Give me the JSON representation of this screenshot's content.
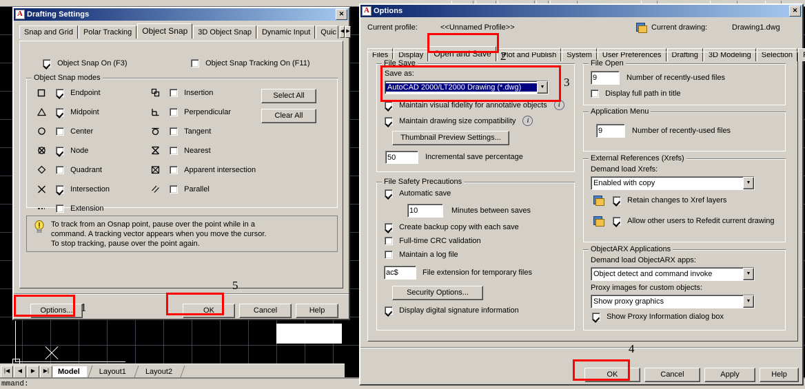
{
  "acad": {
    "command_prompt": "mmand:",
    "nav_buttons": [
      "|◀",
      "◀",
      "▶",
      "▶|"
    ],
    "layout_tabs": [
      {
        "label": "Model",
        "active": true
      },
      {
        "label": "Layout1",
        "active": false
      },
      {
        "label": "Layout2",
        "active": false
      }
    ]
  },
  "drafting": {
    "title": "Drafting Settings",
    "close_label": "✕",
    "tabs": [
      {
        "label": "Snap and Grid",
        "selected": false
      },
      {
        "label": "Polar Tracking",
        "selected": false
      },
      {
        "label": "Object Snap",
        "selected": true
      },
      {
        "label": "3D Object Snap",
        "selected": false
      },
      {
        "label": "Dynamic Input",
        "selected": false
      },
      {
        "label": "Quic",
        "selected": false
      }
    ],
    "scroll_left": "◀",
    "scroll_right": "▶",
    "osnap_on": {
      "label": "Object Snap On (F3)",
      "checked": true
    },
    "osnap_tracking_on": {
      "label": "Object Snap Tracking On (F11)",
      "checked": false
    },
    "modes_group_label": "Object Snap modes",
    "modes_left": [
      {
        "label": "Endpoint",
        "checked": true,
        "icon": "square-icon"
      },
      {
        "label": "Midpoint",
        "checked": true,
        "icon": "triangle-icon"
      },
      {
        "label": "Center",
        "checked": false,
        "icon": "circle-icon"
      },
      {
        "label": "Node",
        "checked": true,
        "icon": "circled-x-icon"
      },
      {
        "label": "Quadrant",
        "checked": false,
        "icon": "diamond-icon"
      },
      {
        "label": "Intersection",
        "checked": true,
        "icon": "x-cross-icon"
      },
      {
        "label": "Extension",
        "checked": false,
        "icon": "dashed-line-icon"
      }
    ],
    "modes_right": [
      {
        "label": "Insertion",
        "checked": false,
        "icon": "insertion-icon"
      },
      {
        "label": "Perpendicular",
        "checked": false,
        "icon": "perpendicular-icon"
      },
      {
        "label": "Tangent",
        "checked": false,
        "icon": "tangent-icon"
      },
      {
        "label": "Nearest",
        "checked": false,
        "icon": "hourglass-icon"
      },
      {
        "label": "Apparent intersection",
        "checked": false,
        "icon": "boxed-x-icon"
      },
      {
        "label": "Parallel",
        "checked": false,
        "icon": "parallel-icon"
      }
    ],
    "select_all_label": "Select All",
    "clear_all_label": "Clear All",
    "tip_line1": "To track from an Osnap point, pause over the point while in a",
    "tip_line2": "command.  A tracking vector appears when you move the cursor.",
    "tip_line3": "To stop tracking, pause over the point again.",
    "options_label": "Options...",
    "ok_label": "OK",
    "cancel_label": "Cancel",
    "help_label": "Help"
  },
  "options": {
    "title": "Options",
    "close_label": "✕",
    "current_profile_label": "Current profile:",
    "current_profile_value": "<<Unnamed Profile>>",
    "current_drawing_label": "Current drawing:",
    "current_drawing_value": "Drawing1.dwg",
    "tabs": [
      {
        "label": "Files",
        "selected": false
      },
      {
        "label": "Display",
        "selected": false
      },
      {
        "label": "Open and Save",
        "selected": true
      },
      {
        "label": "Plot and Publish",
        "selected": false
      },
      {
        "label": "System",
        "selected": false
      },
      {
        "label": "User Preferences",
        "selected": false
      },
      {
        "label": "Drafting",
        "selected": false
      },
      {
        "label": "3D Modeling",
        "selected": false
      },
      {
        "label": "Selection",
        "selected": false
      },
      {
        "label": "Profiles",
        "selected": false
      }
    ],
    "file_save": {
      "group_label": "File Save",
      "save_as_label": "Save as:",
      "save_as_value": "AutoCAD 2000/LT2000 Drawing (*.dwg)",
      "maintain_visual_fidelity": {
        "label": "Maintain visual fidelity for annotative objects",
        "checked": true
      },
      "maintain_size_compat": {
        "label": "Maintain drawing size compatibility",
        "checked": true
      },
      "thumbnail_button": "Thumbnail Preview Settings...",
      "incremental_value": "50",
      "incremental_label": "Incremental save percentage"
    },
    "file_safety": {
      "group_label": "File Safety Precautions",
      "automatic_save": {
        "label": "Automatic save",
        "checked": true
      },
      "minutes_value": "10",
      "minutes_label": "Minutes between saves",
      "create_backup": {
        "label": "Create backup copy with each save",
        "checked": true
      },
      "crc_validation": {
        "label": "Full-time CRC validation",
        "checked": false
      },
      "log_file": {
        "label": "Maintain a log file",
        "checked": false
      },
      "temp_ext_value": "ac$",
      "temp_ext_label": "File extension for temporary files",
      "security_button": "Security Options...",
      "digital_signature": {
        "label": "Display digital signature information",
        "checked": true
      }
    },
    "file_open": {
      "group_label": "File Open",
      "recent_value": "9",
      "recent_label": "Number of recently-used files",
      "full_path": {
        "label": "Display full path in title",
        "checked": false
      }
    },
    "app_menu": {
      "group_label": "Application Menu",
      "recent_value": "9",
      "recent_label": "Number of recently-used files"
    },
    "xrefs": {
      "group_label": "External References (Xrefs)",
      "demand_load_label": "Demand load Xrefs:",
      "demand_load_value": "Enabled with copy",
      "retain_changes": {
        "label": "Retain changes to Xref layers",
        "checked": true
      },
      "allow_refedit": {
        "label": "Allow other users to Refedit current drawing",
        "checked": true
      }
    },
    "objectarx": {
      "group_label": "ObjectARX Applications",
      "demand_load_label": "Demand load ObjectARX apps:",
      "demand_load_value": "Object detect and command invoke",
      "proxy_images_label": "Proxy images for custom objects:",
      "proxy_images_value": "Show proxy graphics",
      "show_proxy_dialog": {
        "label": "Show Proxy Information dialog box",
        "checked": true
      }
    },
    "ok_label": "OK",
    "cancel_label": "Cancel",
    "apply_label": "Apply",
    "help_label": "Help"
  },
  "annotations": {
    "step1": "1",
    "step2": "2",
    "step3": "3",
    "step4": "4",
    "step5": "5",
    "highlight_color": "#ff0000"
  }
}
